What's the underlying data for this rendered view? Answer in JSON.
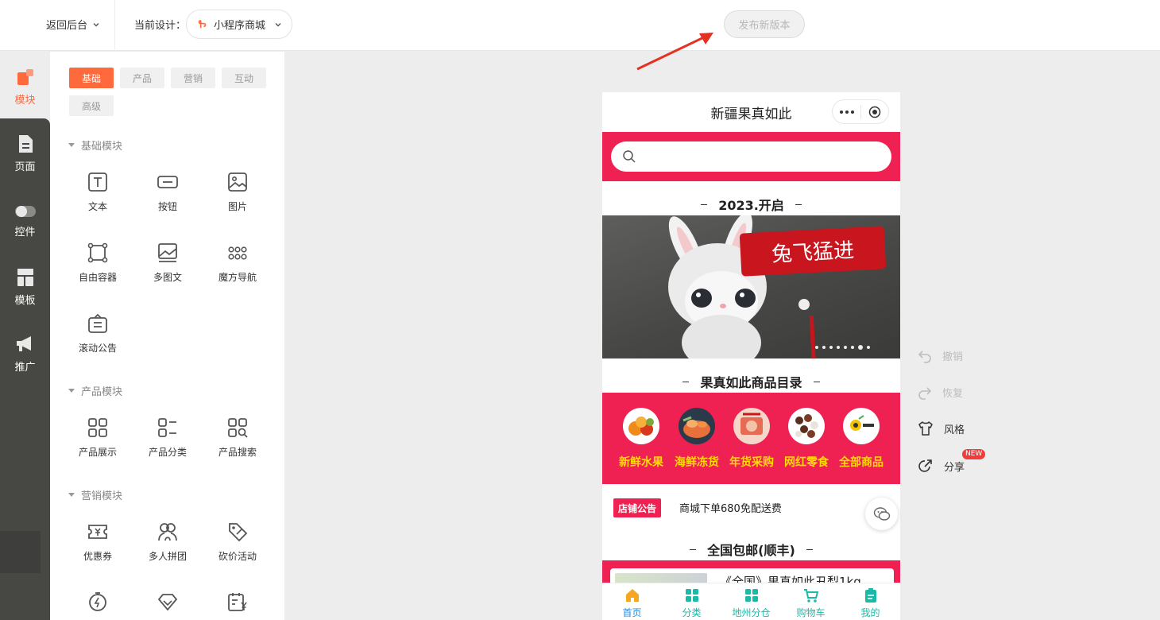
{
  "topbar": {
    "back_label": "返回后台",
    "design_label": "当前设计：",
    "design_value": "小程序商城",
    "publish_label": "发布新版本"
  },
  "nav": [
    {
      "label": "模块",
      "icon": "blocks-icon",
      "active": true
    },
    {
      "label": "页面",
      "icon": "page-icon"
    },
    {
      "label": "控件",
      "icon": "toggle-icon"
    },
    {
      "label": "模板",
      "icon": "template-icon"
    },
    {
      "label": "推广",
      "icon": "megaphone-icon"
    }
  ],
  "panel": {
    "chips": [
      "基础",
      "产品",
      "营销",
      "互动",
      "高级"
    ],
    "sections": [
      {
        "title": "基础模块",
        "items": [
          {
            "label": "文本",
            "icon": "text-icon"
          },
          {
            "label": "按钮",
            "icon": "button-icon"
          },
          {
            "label": "图片",
            "icon": "image-icon"
          },
          {
            "label": "自由容器",
            "icon": "free-container-icon"
          },
          {
            "label": "多图文",
            "icon": "multi-image-icon"
          },
          {
            "label": "魔方导航",
            "icon": "grid-dots-icon"
          },
          {
            "label": "滚动公告",
            "icon": "notice-icon"
          }
        ]
      },
      {
        "title": "产品模块",
        "items": [
          {
            "label": "产品展示",
            "icon": "product-grid-icon"
          },
          {
            "label": "产品分类",
            "icon": "category-list-icon"
          },
          {
            "label": "产品搜索",
            "icon": "product-search-icon"
          }
        ]
      },
      {
        "title": "营销模块",
        "items": [
          {
            "label": "优惠券",
            "icon": "coupon-icon"
          },
          {
            "label": "多人拼团",
            "icon": "group-buy-icon"
          },
          {
            "label": "砍价活动",
            "icon": "bargain-tag-icon"
          },
          {
            "label": "",
            "icon": "timer-flash-icon"
          },
          {
            "label": "",
            "icon": "diamond-icon"
          },
          {
            "label": "",
            "icon": "calendar-yen-icon"
          }
        ]
      }
    ]
  },
  "phone": {
    "title": "新疆果真如此",
    "search_placeholder": "",
    "section1": "2023.开启",
    "banner_sign": "兔飞猛进",
    "section2": "果真如此商品目录",
    "categories": [
      "新鲜水果",
      "海鲜冻货",
      "年货采购",
      "网红零食",
      "全部商品"
    ],
    "notice_tag": "店铺公告",
    "notice_text": "商城下单680免配送费",
    "section3": "全国包邮(顺丰)",
    "product_name": "《全国》果真如此丑梨1kg",
    "tabs": [
      {
        "label": "首页",
        "icon": "home-icon",
        "active": true
      },
      {
        "label": "分类",
        "icon": "category-icon"
      },
      {
        "label": "地州分仓",
        "icon": "warehouse-icon"
      },
      {
        "label": "购物车",
        "icon": "cart-icon"
      },
      {
        "label": "我的",
        "icon": "profile-icon"
      }
    ]
  },
  "tools": [
    {
      "label": "撤销",
      "icon": "undo-icon",
      "enabled": false
    },
    {
      "label": "恢复",
      "icon": "redo-icon",
      "enabled": false
    },
    {
      "label": "风格",
      "icon": "shirt-icon",
      "enabled": true
    },
    {
      "label": "分享",
      "icon": "share-icon",
      "enabled": true,
      "badge": "NEW"
    }
  ],
  "colors": {
    "accent": "#ff6a3d",
    "brand_red": "#ee2152",
    "category_text": "#ffdc00",
    "tab_active": "#1f8ee8",
    "tab_inactive": "#1bb9a8"
  }
}
